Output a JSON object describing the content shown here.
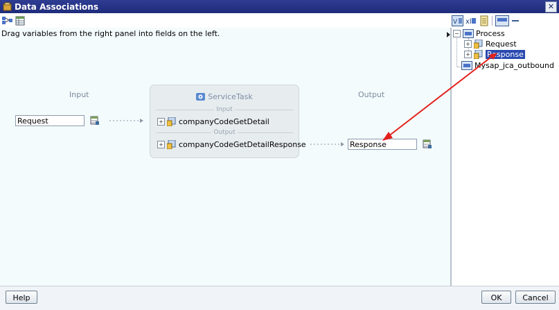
{
  "window": {
    "title": "Data Associations",
    "close_label": "✕"
  },
  "instruction": "Drag variables from the right panel into fields on the left.",
  "input": {
    "label": "Input",
    "value": "Request"
  },
  "output": {
    "label": "Output",
    "value": "Response"
  },
  "service_task": {
    "title": "ServiceTask",
    "input_section": "Input",
    "output_section": "Output",
    "input_item": "companyCodeGetDetail",
    "output_item": "companyCodeGetDetailResponse",
    "expander": "+"
  },
  "tree": {
    "root": "Process",
    "children": [
      "Request",
      "Response"
    ],
    "sibling": "Mysap_jca_outbound",
    "selected": "Response",
    "expander": "+",
    "collapser": "−"
  },
  "buttons": {
    "help": "Help",
    "ok": "OK",
    "cancel": "Cancel"
  },
  "colors": {
    "titlebar": "#1f2c7c",
    "arrow": "#e3201b",
    "selection": "#2a4ab0"
  }
}
